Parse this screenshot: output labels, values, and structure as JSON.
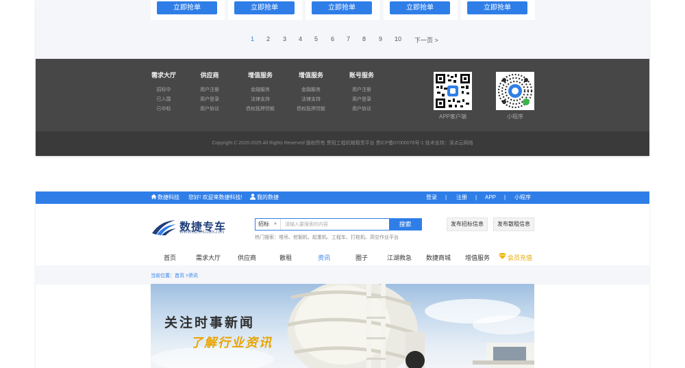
{
  "cards": {
    "grab_label": "立即抢单"
  },
  "pagination": {
    "pages": [
      "1",
      "2",
      "3",
      "4",
      "5",
      "6",
      "7",
      "8",
      "9",
      "10"
    ],
    "active": "1",
    "next": "下一页 >"
  },
  "footer": {
    "columns": [
      {
        "title": "需求大厅",
        "links": [
          "招标中",
          "已入围",
          "已中标"
        ]
      },
      {
        "title": "供应商",
        "links": [
          "用户注册",
          "用户登录",
          "用户协议"
        ]
      },
      {
        "title": "增值服务",
        "links": [
          "金融服务",
          "法律支持",
          "债权抵押贷款"
        ]
      },
      {
        "title": "增值服务",
        "links": [
          "金融服务",
          "法律支持",
          "债权抵押贷款"
        ]
      },
      {
        "title": "账号服务",
        "links": [
          "用户注册",
          "用户登录",
          "用户协议"
        ]
      }
    ],
    "qr": [
      {
        "label": "APP客户端"
      },
      {
        "label": "小程序"
      }
    ],
    "copyright": "Copyright C 2020-2025 All Rights Reserved 版权所有 贵阳工程机械租赁平台 贵ICP备07000076号-1    技术支持：深点云网络"
  },
  "topbar": {
    "brand": "数捷科技",
    "welcome": "您好! 欢迎来数捷科技!",
    "my": "我的数捷",
    "links": [
      "登录",
      "|",
      "注册",
      "|",
      "APP",
      "|",
      "小程序"
    ]
  },
  "header": {
    "logo_name": "数捷专车",
    "logo_url": "WWW.GZSHUJIEKJ.CN",
    "search_type": "招标",
    "search_placeholder": "请输入要搜索的内容",
    "search_button": "搜索",
    "hot": "热门搜索：塔吊、挖掘机、起重机、工程车、打桩机、高空作业平台",
    "publish_bid": "发布招标信息",
    "publish_rent": "发布散租信息"
  },
  "nav": {
    "items": [
      "首页",
      "需求大厅",
      "供应商",
      "散租",
      "资讯",
      "圈子",
      "江湖救急",
      "数捷商城",
      "增值服务"
    ],
    "active": "资讯",
    "vip": "会员充值"
  },
  "breadcrumb": "当前位置：首页 >资讯",
  "banner": {
    "line1": "关注时事新闻",
    "line2": "了解行业资讯"
  },
  "colors": {
    "accent": "#2f7ee8",
    "footer_bg": "#474747",
    "vip": "#e8a800"
  }
}
